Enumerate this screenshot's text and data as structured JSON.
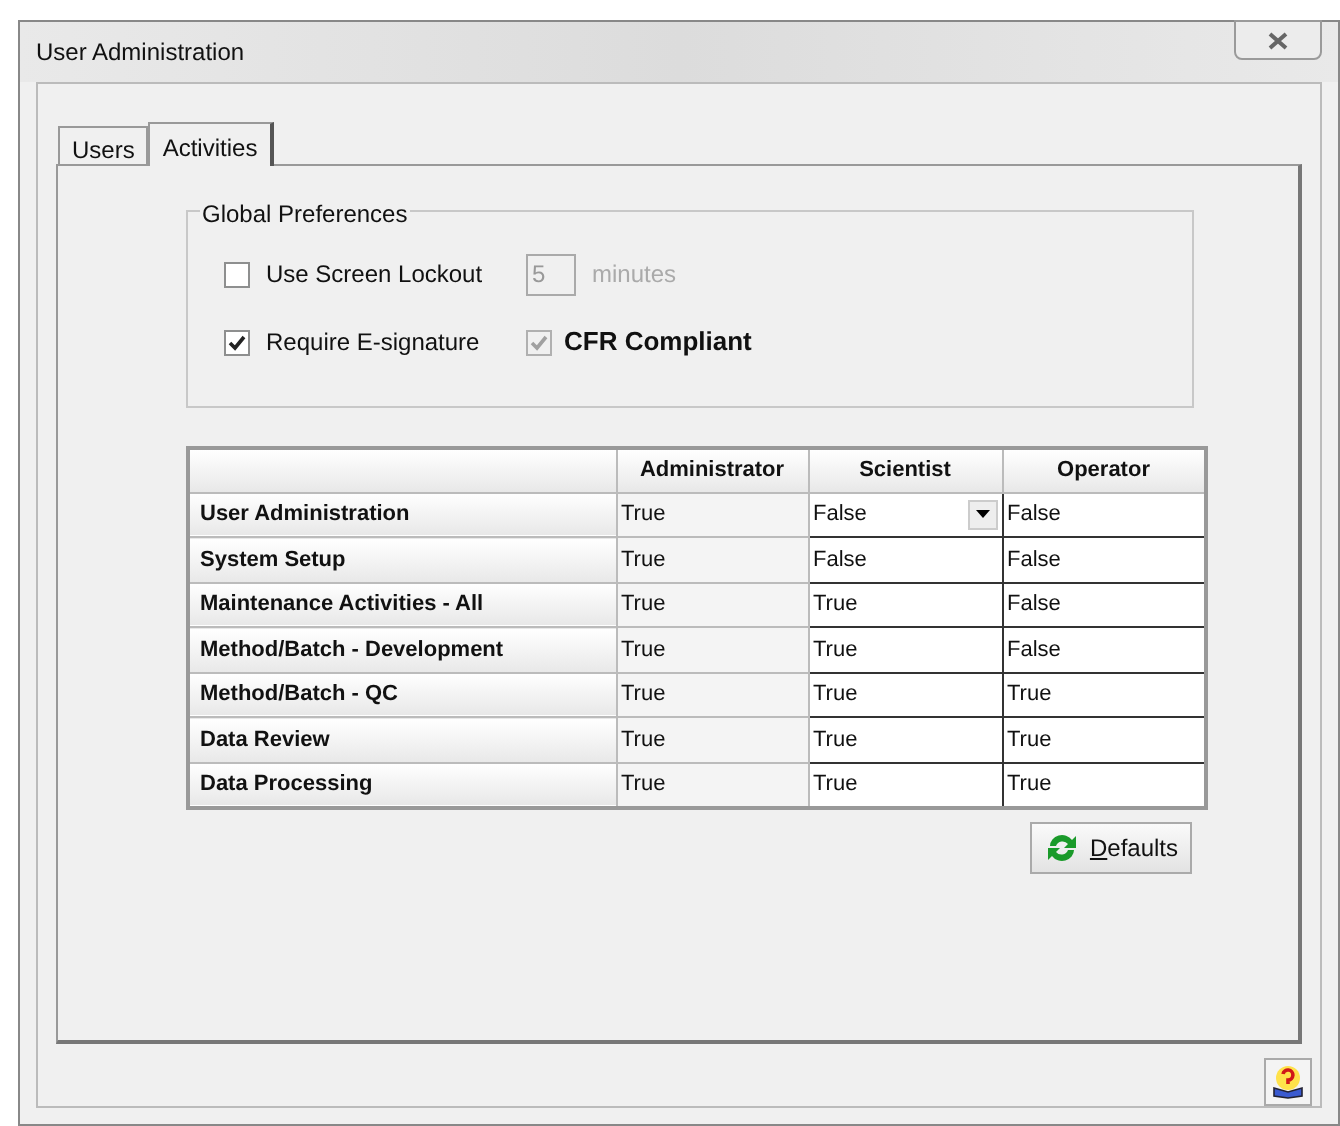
{
  "window": {
    "title": "User Administration"
  },
  "tabs": [
    {
      "label": "Users",
      "selected": false
    },
    {
      "label": "Activities",
      "selected": true
    }
  ],
  "global_preferences": {
    "title": "Global Preferences",
    "screen_lockout": {
      "label": "Use Screen Lockout",
      "checked": false,
      "value": "5",
      "unit": "minutes",
      "disabled": true
    },
    "e_signature": {
      "label": "Require E-signature",
      "checked": true
    },
    "cfr_compliant": {
      "label": "CFR Compliant",
      "checked": true,
      "disabled": true
    }
  },
  "table": {
    "columns": [
      "Administrator",
      "Scientist",
      "Operator"
    ],
    "rows": [
      {
        "activity": "User Administration",
        "cells": [
          {
            "kind": "text",
            "value": "True"
          },
          {
            "kind": "dropdown",
            "value": "False"
          },
          {
            "kind": "text",
            "value": "False"
          }
        ]
      },
      {
        "activity": "System Setup",
        "cells": [
          {
            "kind": "text",
            "value": "True"
          },
          {
            "kind": "text",
            "value": "False"
          },
          {
            "kind": "text",
            "value": "False"
          }
        ]
      },
      {
        "activity": "Maintenance Activities - All",
        "cells": [
          {
            "kind": "text",
            "value": "True"
          },
          {
            "kind": "text",
            "value": "True"
          },
          {
            "kind": "text",
            "value": "False"
          }
        ]
      },
      {
        "activity": "Method/Batch - Development",
        "cells": [
          {
            "kind": "text",
            "value": "True"
          },
          {
            "kind": "text",
            "value": "True"
          },
          {
            "kind": "text",
            "value": "False"
          }
        ]
      },
      {
        "activity": "Method/Batch - QC",
        "cells": [
          {
            "kind": "text",
            "value": "True"
          },
          {
            "kind": "text",
            "value": "True"
          },
          {
            "kind": "text",
            "value": "True"
          }
        ]
      },
      {
        "activity": "Data Review",
        "cells": [
          {
            "kind": "text",
            "value": "True"
          },
          {
            "kind": "text",
            "value": "True"
          },
          {
            "kind": "text",
            "value": "True"
          }
        ]
      },
      {
        "activity": "Data Processing",
        "cells": [
          {
            "kind": "text",
            "value": "True"
          },
          {
            "kind": "text",
            "value": "True"
          },
          {
            "kind": "text",
            "value": "True"
          }
        ]
      }
    ]
  },
  "defaults_button": "Defaults"
}
